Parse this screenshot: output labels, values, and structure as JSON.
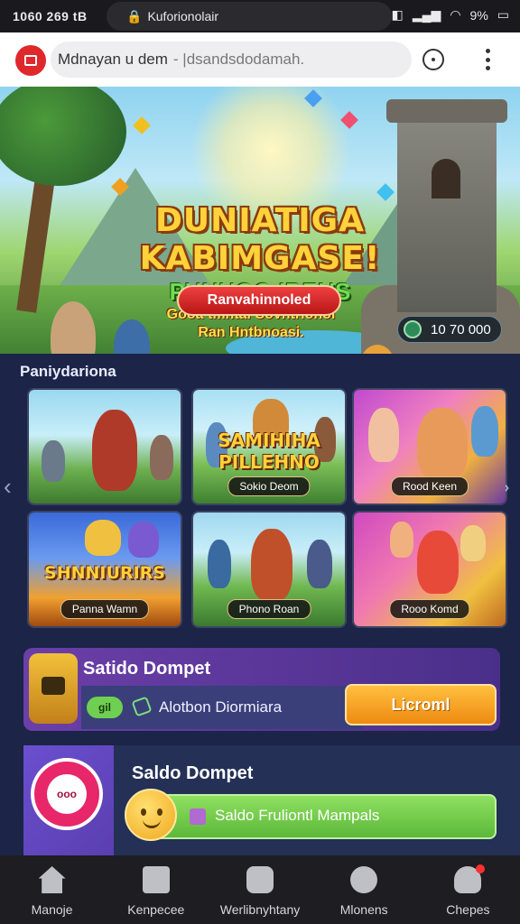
{
  "status_bar": {
    "time": "1060 269 tB",
    "url_pill": "Kuforionolair",
    "battery": "9%"
  },
  "browser": {
    "site": "Mdnayan u dem",
    "path": "- |dsandsdodamah.",
    "accent": "#e0282c"
  },
  "hero": {
    "title_line1": "DUNIATIGA",
    "title_line2": "KABIMGASE!",
    "subtitle": "PUNHOO IRENS",
    "tagline1": "Gooa tmntai Sovntrionol",
    "tagline2": "Ran Hntbnoasi.",
    "cta_label": "Ranvahinnoled",
    "balance": "10 70 000"
  },
  "section": {
    "title": "Paniydariona"
  },
  "cards": [
    {
      "title1": "",
      "title2": "",
      "label": ""
    },
    {
      "title1": "SAMIHIHA",
      "title2": "PILLEHNO",
      "label": "Sokio Deom"
    },
    {
      "title1": "",
      "title2": "",
      "label": "Rood Keen"
    },
    {
      "title1": "SHNNIURIRS",
      "title2": "",
      "label": "Panna Wamn"
    },
    {
      "title1": "",
      "title2": "",
      "label": "Phono Roan"
    },
    {
      "title1": "",
      "title2": "",
      "label": "Rooo Komd"
    }
  ],
  "wallet_promo": {
    "title": "Satido Dompet",
    "badge": "gil",
    "text": "Alotbon Diormiara",
    "button": "Licroml"
  },
  "wallet_saldo": {
    "title": "Saldo Dompet",
    "pin_text": "ooo",
    "bar_text": "Saldo Fruliontl Mampals"
  },
  "nav": [
    {
      "label": "Manoje",
      "icon": "home-icon"
    },
    {
      "label": "Kenpecee",
      "icon": "bag-icon"
    },
    {
      "label": "Werlibnyhtany",
      "icon": "box-icon"
    },
    {
      "label": "Mlonens",
      "icon": "heart-icon"
    },
    {
      "label": "Chepes",
      "icon": "user-icon"
    }
  ],
  "colors": {
    "background": "#1c2447",
    "cta_red": "#e02020",
    "button_orange": "#ee8a10",
    "bar_green": "#6fcf50"
  }
}
